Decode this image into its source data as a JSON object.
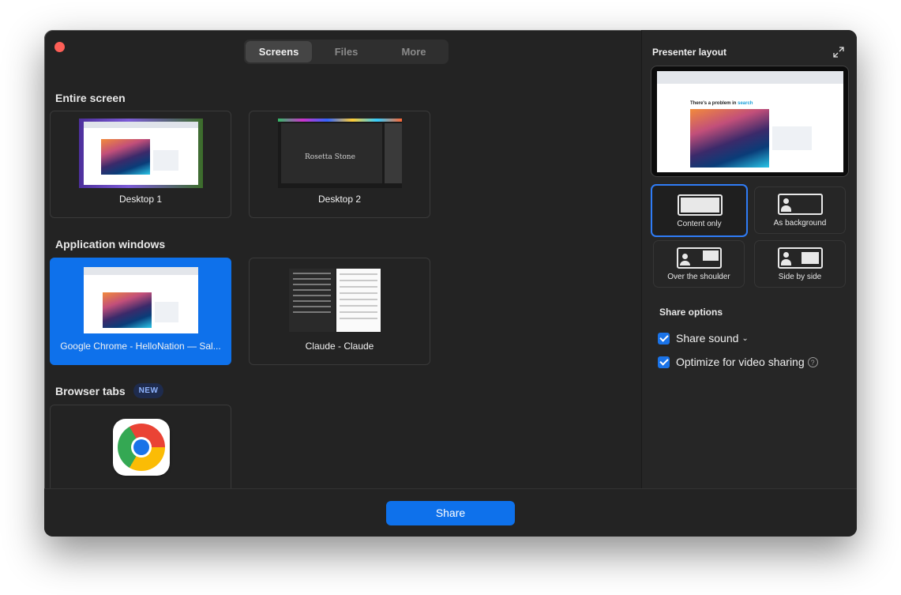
{
  "tabs": [
    {
      "label": "Screens",
      "active": true
    },
    {
      "label": "Files",
      "active": false
    },
    {
      "label": "More",
      "active": false
    }
  ],
  "sections": {
    "entire_screen": "Entire screen",
    "application_windows": "Application windows",
    "browser_tabs": "Browser tabs",
    "new_badge": "NEW"
  },
  "screens": [
    {
      "label": "Desktop 1"
    },
    {
      "label": "Desktop 2",
      "thumb_text": "Rosetta Stone"
    }
  ],
  "app_windows": [
    {
      "label": "Google Chrome - HelloNation — Sal...",
      "selected": true
    },
    {
      "label": "Claude - Claude",
      "selected": false
    }
  ],
  "presenter": {
    "title": "Presenter layout",
    "preview_text_a": "There's a problem in ",
    "preview_text_b": "search",
    "layouts": [
      {
        "label": "Content only",
        "selected": true
      },
      {
        "label": "As background",
        "selected": false
      },
      {
        "label": "Over the shoulder",
        "selected": false
      },
      {
        "label": "Side by side",
        "selected": false
      }
    ]
  },
  "share_options": {
    "title": "Share options",
    "share_sound": {
      "label": "Share sound",
      "checked": true
    },
    "optimize_video": {
      "label": "Optimize for video sharing",
      "checked": true
    },
    "help_glyph": "?"
  },
  "footer": {
    "share_label": "Share"
  },
  "colors": {
    "accent": "#0e71eb",
    "close": "#fe5f57",
    "background": "#232323"
  }
}
